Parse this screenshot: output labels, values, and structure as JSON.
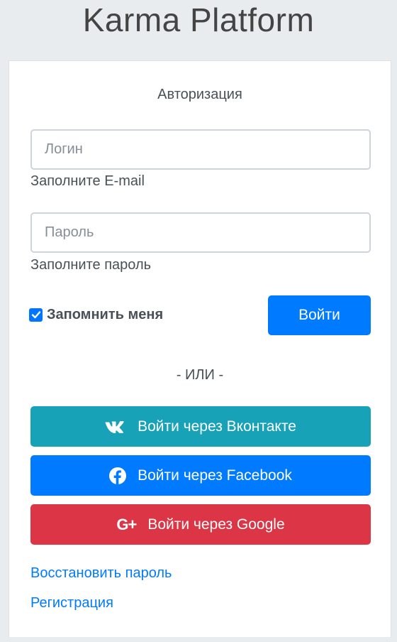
{
  "app": {
    "title": "Karma Platform"
  },
  "auth": {
    "heading": "Авторизация",
    "login": {
      "placeholder": "Логин",
      "value": "",
      "hint": "Заполните E-mail"
    },
    "password": {
      "placeholder": "Пароль",
      "value": "",
      "hint": "Заполните пароль"
    },
    "remember_me": {
      "label": "Запомнить меня",
      "checked": true
    },
    "submit_label": "Войти",
    "divider": "- ИЛИ -",
    "social": {
      "vk": {
        "label": "Войти через Вконтакте",
        "icon": "vk-icon",
        "color": "#17a2b8"
      },
      "facebook": {
        "label": "Войти через Facebook",
        "icon": "facebook-icon",
        "color": "#007bff"
      },
      "google": {
        "label": "Войти через Google",
        "icon": "google-plus-icon",
        "color": "#dc3545"
      }
    },
    "links": {
      "restore": "Восстановить пароль",
      "register": "Регистрация"
    }
  },
  "colors": {
    "primary": "#007bff",
    "info": "#17a2b8",
    "danger": "#dc3545",
    "background": "#e9ecef"
  }
}
